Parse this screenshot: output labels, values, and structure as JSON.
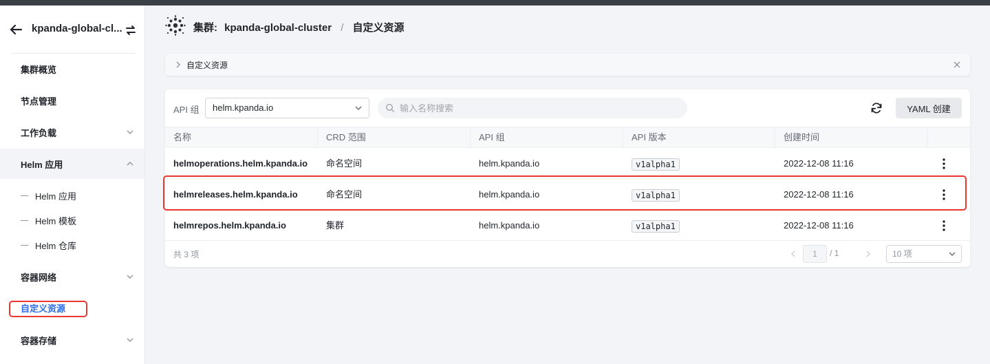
{
  "sidebar": {
    "cluster_name": "kpanda-global-cl...",
    "items": [
      {
        "label": "集群概览"
      },
      {
        "label": "节点管理"
      },
      {
        "label": "工作负载"
      },
      {
        "label": "Helm 应用"
      },
      {
        "label": "容器网络"
      },
      {
        "label": "自定义资源"
      },
      {
        "label": "容器存储"
      }
    ],
    "helm_sub": [
      "Helm 应用",
      "Helm 模板",
      "Helm 仓库"
    ],
    "active_item": "自定义资源"
  },
  "header": {
    "prefix": "集群:",
    "cluster": "kpanda-global-cluster",
    "separator": "/",
    "page": "自定义资源"
  },
  "infobar": {
    "label": "自定义资源"
  },
  "toolbar": {
    "api_group_label": "API 组",
    "api_group_value": "helm.kpanda.io",
    "search_placeholder": "输入名称搜索",
    "yaml_button": "YAML 创建"
  },
  "table": {
    "columns": [
      "名称",
      "CRD 范围",
      "API 组",
      "API 版本",
      "创建时间"
    ],
    "rows": [
      {
        "name": "helmoperations.helm.kpanda.io",
        "scope": "命名空间",
        "group": "helm.kpanda.io",
        "version": "v1alpha1",
        "created": "2022-12-08 11:16"
      },
      {
        "name": "helmreleases.helm.kpanda.io",
        "scope": "命名空间",
        "group": "helm.kpanda.io",
        "version": "v1alpha1",
        "created": "2022-12-08 11:16"
      },
      {
        "name": "helmrepos.helm.kpanda.io",
        "scope": "集群",
        "group": "helm.kpanda.io",
        "version": "v1alpha1",
        "created": "2022-12-08 11:16"
      }
    ]
  },
  "pagination": {
    "total_text": "共 3 项",
    "current_page": "1",
    "total_pages": "/ 1",
    "page_size": "10 项"
  },
  "colors": {
    "accent": "#2f6be5",
    "highlight": "#e8372f"
  }
}
